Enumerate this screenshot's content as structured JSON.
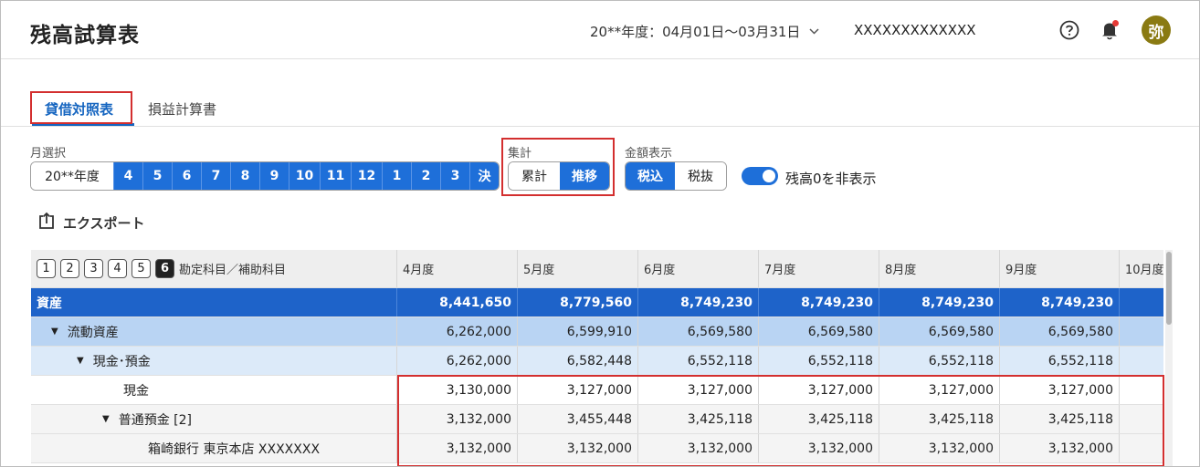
{
  "header": {
    "title": "残高試算表",
    "period": "20**年度：04月01日〜03月31日",
    "company": "XXXXXXXXXXXXX",
    "avatar": "弥",
    "icons": {
      "help": "help-circle-icon",
      "bell": "bell-icon",
      "period_dropdown": "chevron-down-icon"
    }
  },
  "tabs": [
    {
      "label": "貸借対照表",
      "active": true
    },
    {
      "label": "損益計算書",
      "active": false
    }
  ],
  "month_select": {
    "label": "月選択",
    "year": "20**年度",
    "months": [
      "4",
      "5",
      "6",
      "7",
      "8",
      "9",
      "10",
      "11",
      "12",
      "1",
      "2",
      "3",
      "決"
    ]
  },
  "aggregation": {
    "label": "集計",
    "options": [
      "累計",
      "推移"
    ],
    "selected": "推移"
  },
  "amount_display": {
    "label": "金額表示",
    "options": [
      "税込",
      "税抜"
    ],
    "selected": "税込"
  },
  "hide_zero": {
    "label": "残高0を非表示",
    "on": true
  },
  "export": {
    "label": "エクスポート"
  },
  "table": {
    "levels": [
      "1",
      "2",
      "3",
      "4",
      "5",
      "6"
    ],
    "active_level": "6",
    "account_header": "勘定科目／補助科目",
    "columns": [
      "4月度",
      "5月度",
      "6月度",
      "7月度",
      "8月度",
      "9月度",
      "10月度"
    ],
    "rows": [
      {
        "name": "資産",
        "caret": "",
        "values": [
          "8,441,650",
          "8,779,560",
          "8,749,230",
          "8,749,230",
          "8,749,230",
          "8,749,230",
          ""
        ]
      },
      {
        "name": "流動資産",
        "caret": "▼",
        "values": [
          "6,262,000",
          "6,599,910",
          "6,569,580",
          "6,569,580",
          "6,569,580",
          "6,569,580",
          ""
        ]
      },
      {
        "name": "現金･預金",
        "caret": "▼",
        "values": [
          "6,262,000",
          "6,582,448",
          "6,552,118",
          "6,552,118",
          "6,552,118",
          "6,552,118",
          ""
        ]
      },
      {
        "name": "現金",
        "caret": "",
        "values": [
          "3,130,000",
          "3,127,000",
          "3,127,000",
          "3,127,000",
          "3,127,000",
          "3,127,000",
          ""
        ]
      },
      {
        "name": "普通預金 [2]",
        "caret": "▼",
        "values": [
          "3,132,000",
          "3,455,448",
          "3,425,118",
          "3,425,118",
          "3,425,118",
          "3,425,118",
          ""
        ]
      },
      {
        "name": "箱崎銀行 東京本店 XXXXXXX",
        "caret": "",
        "values": [
          "3,132,000",
          "3,132,000",
          "3,132,000",
          "3,132,000",
          "3,132,000",
          "3,132,000",
          ""
        ]
      }
    ]
  },
  "colors": {
    "accent": "#1e6fd9",
    "highlight_box": "#d32f2f",
    "asset_row": "#1e63c9"
  }
}
